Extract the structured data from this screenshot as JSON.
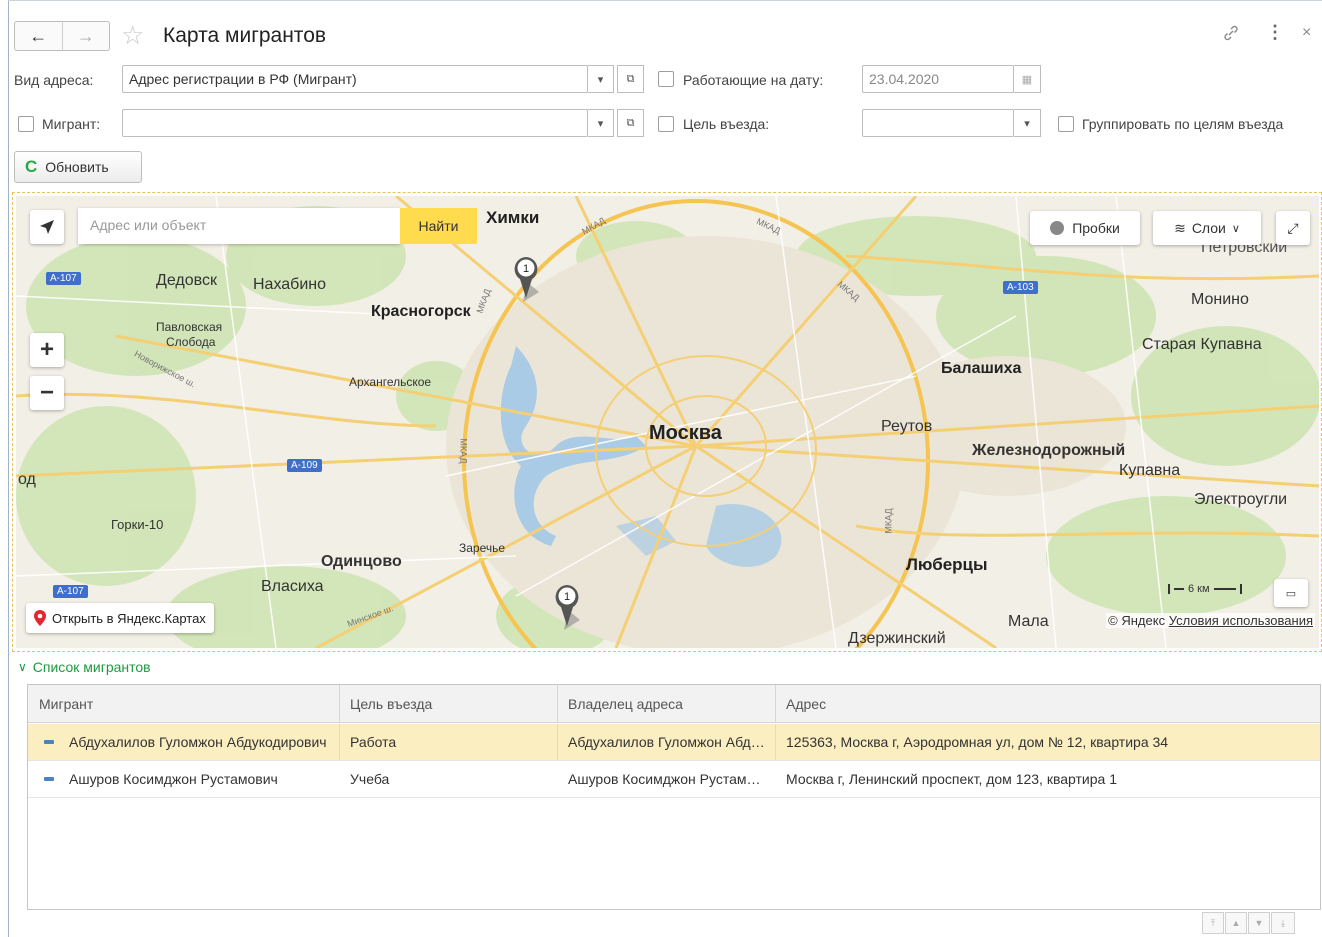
{
  "window": {
    "title": "Карта мигрантов",
    "back_label": "←",
    "forward_label": "→",
    "more_label": "⋮",
    "close_label": "×"
  },
  "form": {
    "address_type_label": "Вид адреса:",
    "address_type_value": "Адрес регистрации в РФ (Мигрант)",
    "working_on_date_label": "Работающие на дату:",
    "working_on_date_value": "23.04.2020",
    "working_on_date_checked": false,
    "migrant_label": "Мигрант:",
    "migrant_checked": false,
    "migrant_value": "",
    "entry_purpose_label": "Цель въезда:",
    "entry_purpose_checked": false,
    "entry_purpose_value": "",
    "group_by_purpose_label": "Группировать по целям въезда",
    "group_by_purpose_checked": false,
    "refresh_label": "Обновить"
  },
  "map": {
    "search_placeholder": "Адрес или объект",
    "search_button": "Найти",
    "traffic_label": "Пробки",
    "layers_label": "Слои",
    "open_in_yandex": "Открыть в Яндекс.Картах",
    "scale_label": "6 км",
    "copyright": "© Яндекс",
    "terms": "Условия использования",
    "marker_count": "1",
    "places": {
      "khimki": "Химки",
      "dedovsk": "Дедовск",
      "nakhabino": "Нахабино",
      "krasnogorsk": "Красногорск",
      "pavlovskaya": "Павловская",
      "sloboda": "Слобода",
      "arkhangelskoe": "Архангельское",
      "moskva": "Москва",
      "balashikha": "Балашиха",
      "reutov": "Реутов",
      "zheleznodorozhny": "Железнодорожный",
      "kupavna": "Купавна",
      "staraya_kupavna": "Старая Купавна",
      "monino": "Монино",
      "elektrougli": "Электроугли",
      "petrovsky": "Петровский",
      "gorki10": "Горки-10",
      "odintsovo": "Одинцово",
      "zarechye": "Заречье",
      "vlasikha": "Власиха",
      "lyubertsy": "Люберцы",
      "dzerzhinsky": "Дзержинский",
      "mala": "Мала",
      "od": "од"
    },
    "roads": {
      "a107": "A-107",
      "a103": "A-103",
      "a109": "A-109",
      "mkad": "МКАД",
      "novorizhskoe": "Новорижское ш.",
      "minskoe": "Минское ш."
    }
  },
  "list": {
    "section_title": "Список мигрантов",
    "columns": [
      "Мигрант",
      "Цель въезда",
      "Владелец адреса",
      "Адрес"
    ],
    "rows": [
      {
        "migrant": "Абдухалилов Гуломжон Абдукодирович",
        "purpose": "Работа",
        "owner": "Абдухалилов Гуломжон Абдукодирович",
        "address": "125363, Москва г, Аэродромная ул, дом № 12, квартира 34",
        "selected": true
      },
      {
        "migrant": "Ашуров Косимджон Рустамович",
        "purpose": "Учеба",
        "owner": "Ашуров Косимджон Рустамович",
        "address": "Москва г, Ленинский проспект, дом 123, квартира 1",
        "selected": false
      }
    ]
  },
  "colors": {
    "accent_green": "#1e9a3f",
    "selected_row": "#fbeec1",
    "search_button": "#ffdb4d",
    "road_shield": "#3f6ecb"
  }
}
